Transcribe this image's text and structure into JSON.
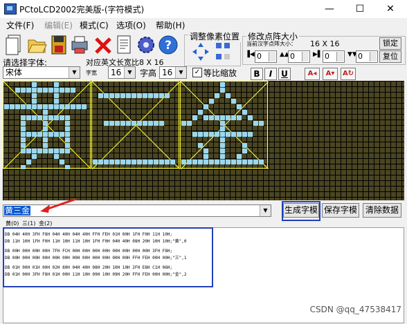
{
  "window": {
    "title": "PCtoLCD2002完美版-(字符模式)",
    "minimize": "—",
    "maximize": "☐",
    "close": "✕"
  },
  "menu": [
    {
      "label": "文件(F)",
      "enabled": true
    },
    {
      "label": "编辑(E)",
      "enabled": false
    },
    {
      "label": "模式(C)",
      "enabled": true
    },
    {
      "label": "选项(O)",
      "enabled": true
    },
    {
      "label": "帮助(H)",
      "enabled": true
    }
  ],
  "toolbar": [
    "new-file-icon",
    "open-folder-icon",
    "save-icon",
    "print-icon",
    "delete-icon",
    "notes-icon",
    "settings-gear-icon",
    "help-icon"
  ],
  "pixel_adjust": {
    "label": "调整像素位置"
  },
  "resize": {
    "label": "修改点阵大小",
    "current_label": "当前汉字点阵大小：",
    "current_value": "16 X 16",
    "lock_button": "锁定",
    "restore_button": "复位",
    "spinners": [
      "0",
      "0",
      "0",
      "0"
    ]
  },
  "font": {
    "label": "请选择字体:",
    "name": "宋体",
    "char_width_label": "字宽",
    "char_width": "16",
    "char_height_label": "字高",
    "char_height": "16",
    "eng_ratio": "对应英文长宽比8 X 16",
    "proportional_label": "等比缩放",
    "proportional_checked": true,
    "format_buttons": [
      "B",
      "I",
      "U"
    ]
  },
  "canvas": {
    "grid_color": "#4a4522",
    "pixel_color": "#9ad8f0",
    "box_color": "#ffff33"
  },
  "input": {
    "text": "黄三金"
  },
  "buttons": {
    "generate": "生成字模",
    "save": "保存字模",
    "clear": "清除数据"
  },
  "tabs": [
    "黄(0)",
    "三(1)",
    "金(2)"
  ],
  "output_lines": [
    "DB 04H 40H 3FH F8H 04H 40H 04H 40H FFH FEH 01H 00H 1FH F0H 11H 10H;",
    "DB 11H 10H 1FH F0H 11H 10H 11H 10H 1FH F0H 04H 40H 08H 20H 10H 10H;\"黄\",0",
    "",
    "DB 00H 00H 00H 00H 7FH FCH 00H 00H 00H 00H 00H 00H 00H 00H 3FH F8H;",
    "DB 00H 00H 00H 00H 00H 00H 00H 00H 00H 00H 00H 00H FFH FEH 00H 00H;\"三\",1",
    "",
    "DB 01H 00H 01H 00H 02H 80H 04H 40H 08H 20H 10H 10H 2FH E8H C1H 06H;",
    "DB 01H 00H 3FH F8H 01H 00H 11H 10H 09H 10H 09H 20H FFH FEH 00H 00H;\"金\",2"
  ],
  "watermark": "CSDN @qq_47538417"
}
